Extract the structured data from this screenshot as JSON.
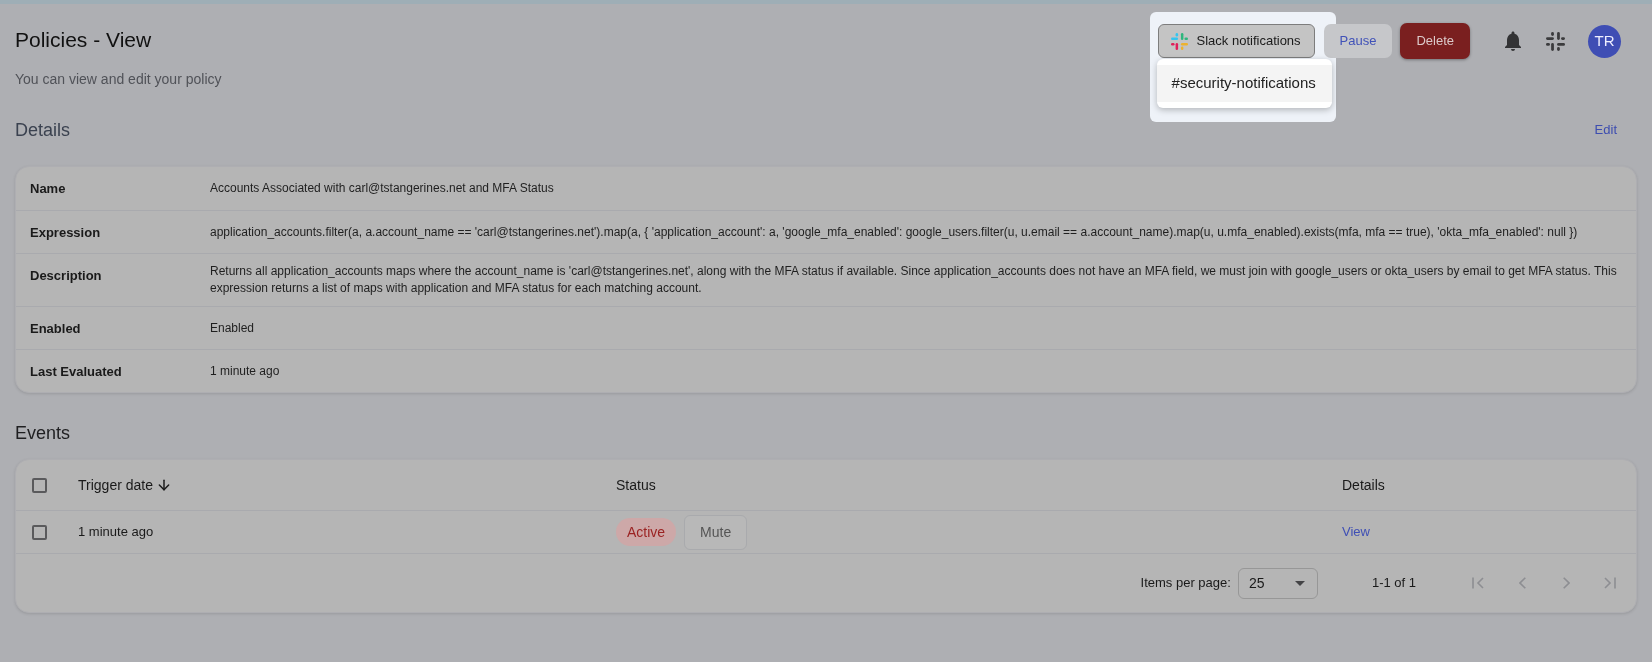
{
  "page": {
    "title": "Policies - View",
    "subtitle": "You can view and edit your policy"
  },
  "toolbar": {
    "slack_button": {
      "label": "Slack notifications",
      "expanded": true,
      "highlighted": true
    },
    "slack_menu": [
      {
        "label": "#security-notifications",
        "hovered": true
      }
    ],
    "buttons": [
      {
        "label": "Pause",
        "kind": "secondary"
      },
      {
        "label": "Delete",
        "kind": "danger"
      }
    ],
    "avatar": {
      "initials": "TR"
    }
  },
  "details": {
    "title": "Details",
    "edit_link": "Edit",
    "rows": [
      {
        "label": "Name",
        "value": "Accounts Associated with carl@tstangerines.net and MFA Status"
      },
      {
        "label": "Expression",
        "value": "application_accounts.filter(a, a.account_name == 'carl@tstangerines.net').map(a, { 'application_account': a, 'google_mfa_enabled': google_users.filter(u, u.email == a.account_name).map(u, u.mfa_enabled).exists(mfa, mfa == true), 'okta_mfa_enabled': null })"
      },
      {
        "label": "Description",
        "value": "Returns all application_accounts maps where the account_name is 'carl@tstangerines.net', along with the MFA status if available. Since application_accounts does not have an MFA field, we must join with google_users or okta_users by email to get MFA status. This expression returns a list of maps with application and MFA status for each matching account."
      },
      {
        "label": "Enabled",
        "value": "Enabled"
      },
      {
        "label": "Last Evaluated",
        "value": "1 minute ago"
      }
    ]
  },
  "events": {
    "title": "Events",
    "select_all": {
      "checked": false
    },
    "columns": [
      {
        "label": "Trigger date",
        "sorted": true,
        "descending": true
      },
      {
        "label": "Status",
        "sorted": false
      },
      {
        "label": "Details",
        "sorted": false
      }
    ],
    "rows": [
      {
        "checked": false,
        "trigger_date": "1 minute ago",
        "status": {
          "label": "Active",
          "kind": "active"
        },
        "action": "Mute",
        "details_link": "View"
      }
    ],
    "pagination": {
      "items_per_page_label": "Items per page:",
      "items_per_page": "25",
      "range": "1-1 of 1",
      "nav": [
        {
          "kind": "first",
          "disabled": true
        },
        {
          "kind": "previous",
          "disabled": true
        },
        {
          "kind": "next",
          "disabled": true
        },
        {
          "kind": "last",
          "disabled": true
        }
      ]
    }
  }
}
